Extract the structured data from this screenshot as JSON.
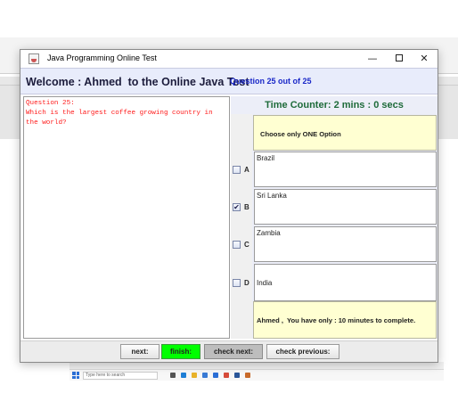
{
  "window": {
    "title": "Java Programming Online Test",
    "minimize": "—",
    "close": "✕"
  },
  "header": {
    "welcome": "Welcome : Ahmed  to the Online Java Test",
    "question_count": "Question 25 out of 25"
  },
  "question": {
    "text": "Question 25:\nWhich is the largest coffee growing country in\nthe world?"
  },
  "timer": {
    "text": "Time Counter:  2 mins : 0 secs"
  },
  "instruction": "Choose only ONE Option",
  "options": [
    {
      "letter": "A",
      "text": "Brazil",
      "checked": false
    },
    {
      "letter": "B",
      "text": "Sri Lanka",
      "checked": true
    },
    {
      "letter": "C",
      "text": "Zambia",
      "checked": false
    },
    {
      "letter": "D",
      "text": "India",
      "checked": false
    }
  ],
  "notice": "Ahmed ,  You have only : 10 minutes to complete.",
  "buttons": {
    "next": "next:",
    "finish": "finish:",
    "check_next": "check next:",
    "check_previous": "check previous:"
  },
  "colors": {
    "question_text": "#ff1a1a",
    "question_count": "#1a28c8",
    "timer": "#1e6b3a",
    "finish_button": "#00ff00",
    "yellow_panel": "#ffffd2",
    "header_bg": "#e8ecfb"
  },
  "taskbar": {
    "search_placeholder": "Type here to search"
  }
}
